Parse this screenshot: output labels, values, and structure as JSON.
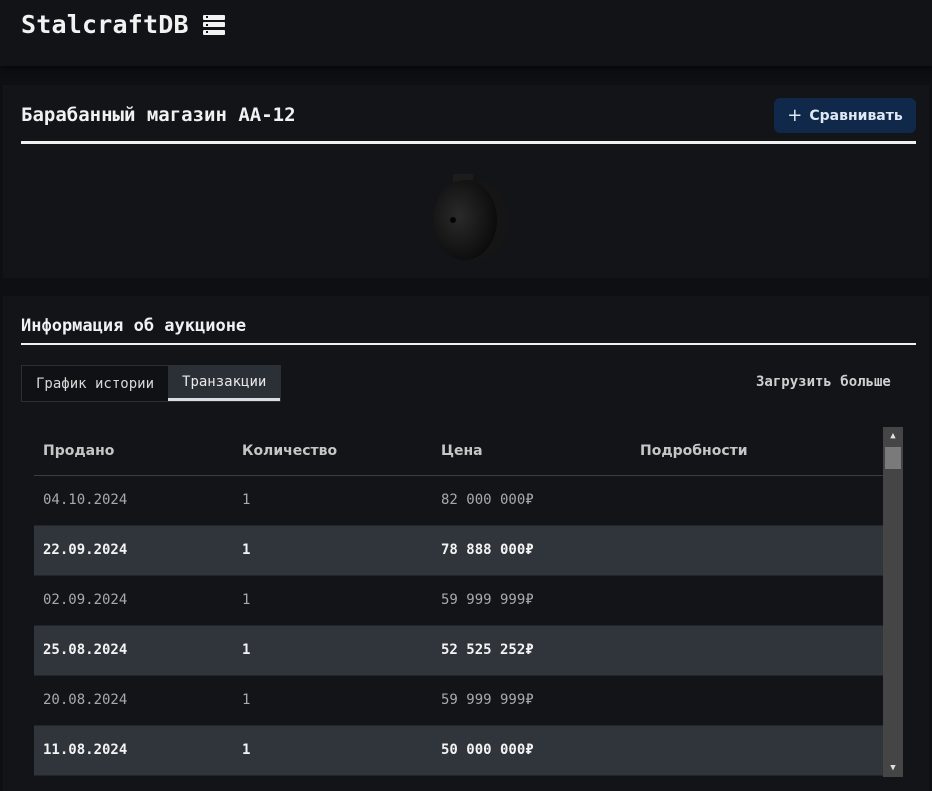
{
  "header": {
    "title": "StalcraftDB",
    "icon": "database-icon"
  },
  "item": {
    "title": "Барабанный магазин АА-12",
    "compare_label": "Сравнивать",
    "compare_icon": "+"
  },
  "auction": {
    "title": "Информация об аукционе",
    "tabs": [
      {
        "label": "График истории",
        "active": false
      },
      {
        "label": "Транзакции",
        "active": true
      }
    ],
    "load_more_label": "Загрузить больше",
    "table": {
      "columns": [
        "Продано",
        "Количество",
        "Цена",
        "Подробности"
      ],
      "rows": [
        {
          "date": "04.10.2024",
          "qty": "1",
          "price": "82 000 000₽",
          "details": ""
        },
        {
          "date": "22.09.2024",
          "qty": "1",
          "price": "78 888 000₽",
          "details": ""
        },
        {
          "date": "02.09.2024",
          "qty": "1",
          "price": "59 999 999₽",
          "details": ""
        },
        {
          "date": "25.08.2024",
          "qty": "1",
          "price": "52 525 252₽",
          "details": ""
        },
        {
          "date": "20.08.2024",
          "qty": "1",
          "price": "59 999 999₽",
          "details": ""
        },
        {
          "date": "11.08.2024",
          "qty": "1",
          "price": "50 000 000₽",
          "details": ""
        }
      ]
    }
  }
}
